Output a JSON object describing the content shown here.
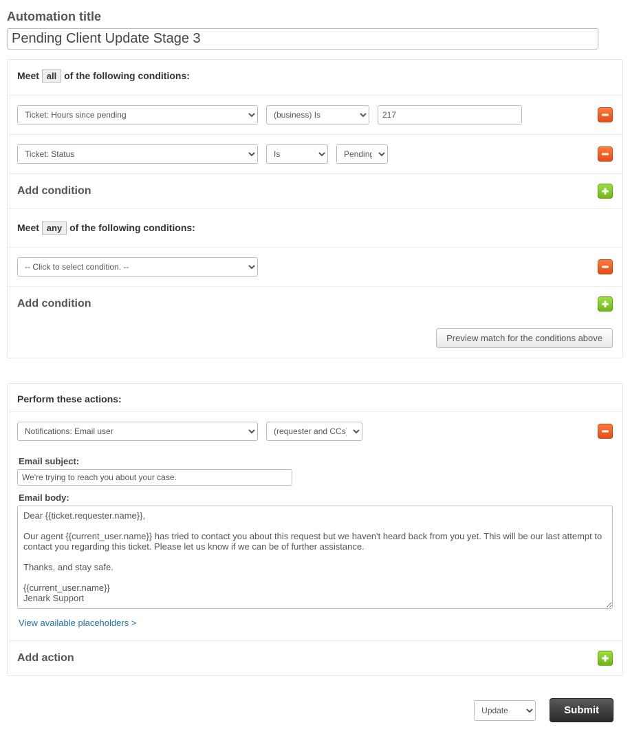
{
  "header": {
    "title_label": "Automation title",
    "title_value": "Pending Client Update Stage 3"
  },
  "conditions": {
    "all": {
      "prefix": "Meet",
      "word": "all",
      "suffix": "of the following conditions:",
      "rows": [
        {
          "field": "Ticket: Hours since pending",
          "op": "(business) Is",
          "value": "217"
        },
        {
          "field": "Ticket: Status",
          "op": "Is",
          "value": "Pending"
        }
      ],
      "add_label": "Add condition"
    },
    "any": {
      "prefix": "Meet",
      "word": "any",
      "suffix": "of the following conditions:",
      "rows": [
        {
          "field": "-- Click to select condition. --"
        }
      ],
      "add_label": "Add condition"
    },
    "preview_button": "Preview match for the conditions above"
  },
  "actions": {
    "heading": "Perform these actions:",
    "rows": [
      {
        "field": "Notifications: Email user",
        "target": "(requester and CCs)"
      }
    ],
    "subject_label": "Email subject:",
    "subject_value": "We're trying to reach you about your case.",
    "body_label": "Email body:",
    "body_value": "Dear {{ticket.requester.name}},\n\nOur agent {{current_user.name}} has tried to contact you about this request but we haven't heard back from you yet. This will be our last attempt to contact you regarding this ticket. Please let us know if we can be of further assistance.\n\nThanks, and stay safe.\n\n{{current_user.name}}\nJenark Support",
    "placeholders_link": "View available placeholders >",
    "add_label": "Add action"
  },
  "footer": {
    "dropdown": "Update",
    "submit": "Submit"
  }
}
